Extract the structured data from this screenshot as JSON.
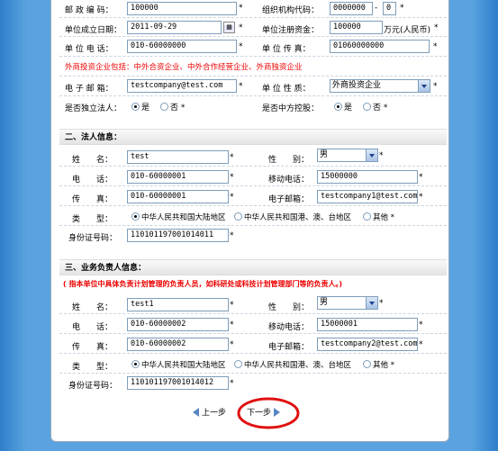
{
  "unit": {
    "postal_code_label": "邮 政 编 码：",
    "postal_code_value": "100000",
    "org_code_label": "组织机构代码：",
    "org_code_value": "0000000",
    "org_code_suffix": "0",
    "org_code_dash": "-",
    "established_label": "单位成立日期：",
    "established_value": "2011-09-29",
    "capital_label": "单位注册资金：",
    "capital_value": "100000",
    "capital_unit": "万元(人民币)",
    "phone_label": "单 位 电 话：",
    "phone_value": "010-60000000",
    "fax_label": "单 位 传 真：",
    "fax_value": "01060000000",
    "foreign_note": "外商投资企业包括：中外合资企业、中外合作经营企业、外商独资企业",
    "email_label": "电 子 邮 箱：",
    "email_value": "testcompany@test.com",
    "nature_label": "单 位 性 质：",
    "nature_value": "外商投资企业",
    "independent_label": "是否独立法人：",
    "yes": "是",
    "no": "否",
    "chinese_control_label": "是否中方控股："
  },
  "legal": {
    "section_title": "二、法人信息：",
    "name_label": "姓　　名：",
    "name_value": "test",
    "gender_label": "性　　别：",
    "gender_value": "男",
    "phone_label": "电　　话：",
    "phone_value": "010-60000001",
    "mobile_label": "移动电话：",
    "mobile_value": "15000000",
    "fax_label": "传　　真：",
    "fax_value": "010-60000001",
    "email_label": "电子邮箱：",
    "email_value": "testcompany1@test.com",
    "type_label": "类　　型：",
    "type_opt1": "中华人民共和国大陆地区",
    "type_opt2": "中华人民共和国港、澳、台地区",
    "type_opt3": "其他",
    "id_label": "身份证号码：",
    "id_value": "110101197001014011"
  },
  "business": {
    "section_title": "三、业务负责人信息：",
    "note": "( 指本单位中具体负责计划管理的负责人员，如科研处或科技计划管理部门等的负责人。)",
    "name_label": "姓　　名：",
    "name_value": "test1",
    "gender_label": "性　　别：",
    "gender_value": "男",
    "phone_label": "电　　话：",
    "phone_value": "010-60000002",
    "mobile_label": "移动电话：",
    "mobile_value": "15000001",
    "fax_label": "传　　真：",
    "fax_value": "010-60000002",
    "email_label": "电子邮箱：",
    "email_value": "testcompany2@test.com",
    "type_label": "类　　型：",
    "type_opt1": "中华人民共和国大陆地区",
    "type_opt2": "中华人民共和国港、澳、台地区",
    "type_opt3": "其他",
    "id_label": "身份证号码：",
    "id_value": "110101197001014012"
  },
  "nav": {
    "prev": "上一步",
    "next": "下一步"
  },
  "required_mark": "*",
  "colors": {
    "background": "#3e8fd2",
    "warning_red": "#e00000",
    "highlight_circle": "#e01010"
  }
}
